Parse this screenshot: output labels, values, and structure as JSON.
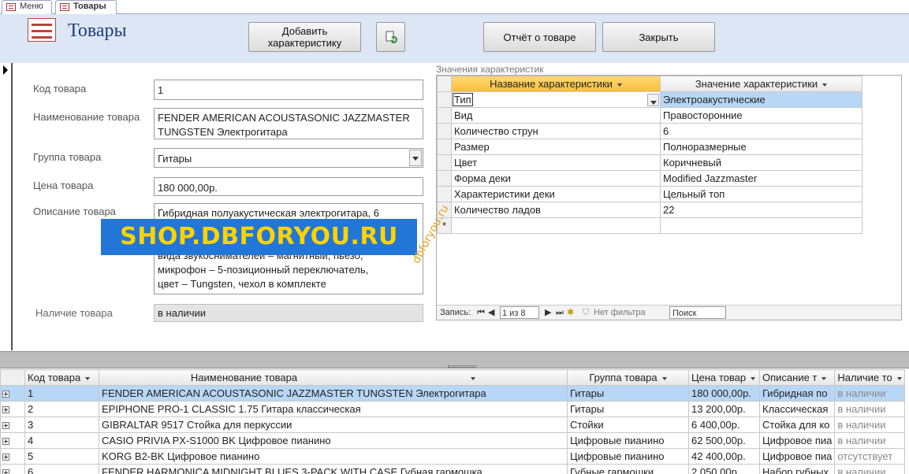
{
  "tabs": [
    {
      "label": "Меню",
      "active": false
    },
    {
      "label": "Товары",
      "active": true
    }
  ],
  "header": {
    "title": "Товары",
    "add_characteristic": "Добавить характеристику",
    "report": "Отчёт о товаре",
    "close": "Закрыть",
    "refresh_icon": "refresh-icon"
  },
  "form": {
    "code_label": "Код товара",
    "code": "1",
    "name_label": "Наименование товара",
    "name": "FENDER AMERICAN ACOUSTASONIC JAZZMASTER TUNGSTEN Электрогитара",
    "group_label": "Группа товара",
    "group": "Гитары",
    "price_label": "Цена товара",
    "price": "180 000,00р.",
    "desc_label": "Описание товара",
    "desc_lines": [
      "Гибридная полуакустическая электрогитара, 6",
      "вида звукоснимателей – магнитный, пьезо,",
      "микрофон – 5-позиционный переключатель,",
      "цвет – Tungsten, чехол в комплекте"
    ],
    "stock_label": "Наличие товара",
    "stock": "в наличии"
  },
  "subform": {
    "caption": "Значения характеристик",
    "col_name": "Название характеристики",
    "col_value": "Значение характеристики",
    "rows": [
      {
        "name": "Тип",
        "value": "Электроакустические"
      },
      {
        "name": "Вид",
        "value": "Правосторонние"
      },
      {
        "name": "Количество струн",
        "value": "6"
      },
      {
        "name": "Размер",
        "value": "Полноразмерные"
      },
      {
        "name": "Цвет",
        "value": "Коричневый"
      },
      {
        "name": "Форма деки",
        "value": "Modified Jazzmaster"
      },
      {
        "name": "Характеристики деки",
        "value": "Цельный топ"
      },
      {
        "name": "Количество ладов",
        "value": "22"
      }
    ],
    "new_row_marker": "*",
    "nav": {
      "record_label": "Запись:",
      "position": "1 из 8",
      "filter": "Нет фильтра",
      "search": "Поиск"
    }
  },
  "watermark": {
    "banner": "SHOP.DBFORYOU.RU",
    "diagonal": "dbforyou.ru"
  },
  "table": {
    "columns": [
      "Код товара",
      "Наименование товара",
      "Группа товара",
      "Цена товар",
      "Описание т",
      "Наличие то"
    ],
    "rows": [
      [
        "1",
        "FENDER AMERICAN ACOUSTASONIC JAZZMASTER TUNGSTEN Электрогитара",
        "Гитары",
        "180 000,00р.",
        "Гибридная по",
        "в наличии"
      ],
      [
        "2",
        "EPIPHONE PRO-1 CLASSIC 1.75 Гитара классическая",
        "Гитары",
        "13 200,00р.",
        "Классическая",
        "в наличии"
      ],
      [
        "3",
        "GIBRALTAR 9517 Стойка для перкуссии",
        "Стойки",
        "6 400,00р.",
        "Стойка для ко",
        "в наличии"
      ],
      [
        "4",
        "CASIO PRIVIA PX-S1000 BK Цифровое пианино",
        "Цифровые пианино",
        "62 500,00р.",
        "Цифровое пиа",
        "в наличии"
      ],
      [
        "5",
        "KORG B2-BK Цифровое пианино",
        "Цифровые пианино",
        "42 400,00р.",
        "Цифровое пиа",
        "отсутствует"
      ],
      [
        "6",
        "FENDER HARMONICA MIDNIGHT BLUES 3-PACK WITH CASE Губная гармошка",
        "Губные гармошки",
        "2 050,00р.",
        "Набор губных",
        "в наличии"
      ]
    ]
  }
}
